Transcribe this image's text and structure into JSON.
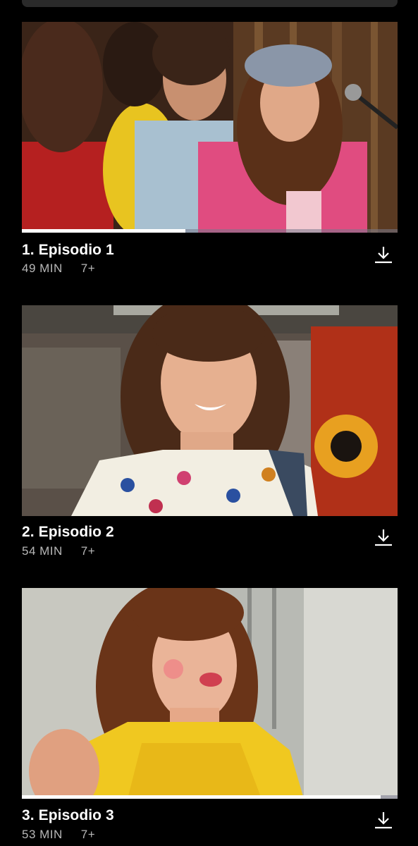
{
  "episodes": [
    {
      "title": "1. Episodio 1",
      "duration": "49 MIN",
      "rating": "7+",
      "progress": 0.435,
      "download_icon": "download-icon"
    },
    {
      "title": "2. Episodio 2",
      "duration": "54 MIN",
      "rating": "7+",
      "progress": 0,
      "download_icon": "download-icon"
    },
    {
      "title": "3. Episodio 3",
      "duration": "53 MIN",
      "rating": "7+",
      "progress": 0.955,
      "download_icon": "download-icon"
    }
  ],
  "colors": {
    "background": "#000000",
    "title": "#ffffff",
    "meta": "#b8b8b8",
    "progress_fill": "#ffffff",
    "progress_track": "#5a5a6a"
  }
}
